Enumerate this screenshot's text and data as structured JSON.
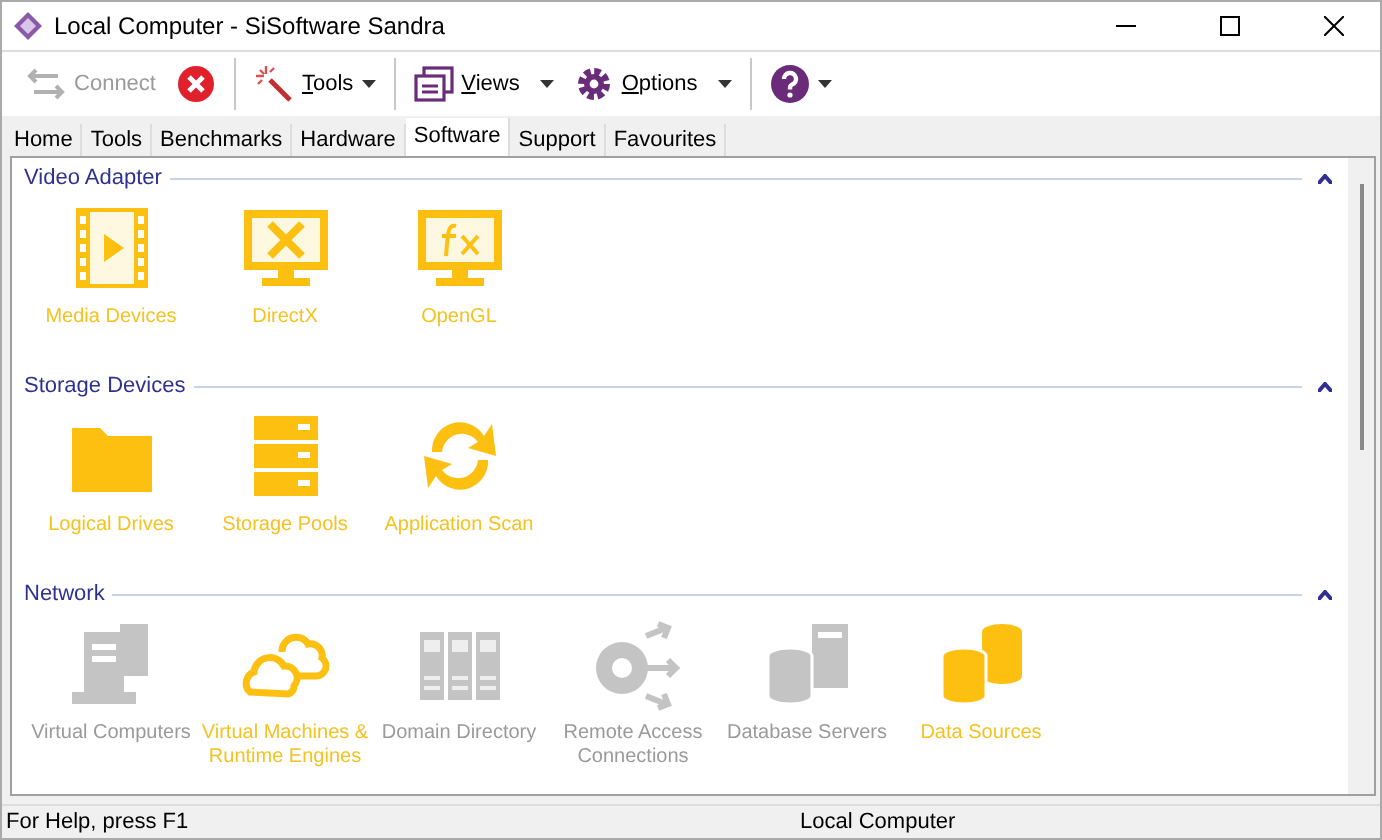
{
  "window": {
    "title": "Local Computer - SiSoftware Sandra"
  },
  "toolbar": [
    {
      "kind": "connect",
      "label": "Connect",
      "disabled": true
    },
    {
      "kind": "stop",
      "disabled": false
    },
    {
      "kind": "tools",
      "label": "Tools",
      "disabled": false
    },
    {
      "kind": "views",
      "label": "Views",
      "disabled": false
    },
    {
      "kind": "options",
      "label": "Options",
      "disabled": false
    },
    {
      "kind": "help",
      "disabled": false
    }
  ],
  "tabs": [
    {
      "label": "Home",
      "selected": false
    },
    {
      "label": "Tools",
      "selected": false
    },
    {
      "label": "Benchmarks",
      "selected": false
    },
    {
      "label": "Hardware",
      "selected": false
    },
    {
      "label": "Software",
      "selected": true
    },
    {
      "label": "Support",
      "selected": false
    },
    {
      "label": "Favourites",
      "selected": false
    }
  ],
  "sections": [
    {
      "title": "Video Adapter",
      "expanded": true,
      "items": [
        {
          "kind": "film",
          "label": "Media Devices",
          "enabled": true
        },
        {
          "kind": "monitor-x",
          "label": "DirectX",
          "enabled": true
        },
        {
          "kind": "monitor-fx",
          "label": "OpenGL",
          "enabled": true
        }
      ]
    },
    {
      "title": "Storage Devices",
      "expanded": true,
      "items": [
        {
          "kind": "folder",
          "label": "Logical Drives",
          "enabled": true
        },
        {
          "kind": "drawers",
          "label": "Storage Pools",
          "enabled": true
        },
        {
          "kind": "refresh",
          "label": "Application Scan",
          "enabled": true
        }
      ]
    },
    {
      "title": "Network",
      "expanded": true,
      "items": [
        {
          "kind": "computer",
          "label": "Virtual Computers",
          "enabled": false
        },
        {
          "kind": "clouds",
          "label": "Virtual Machines & Runtime Engines",
          "enabled": true
        },
        {
          "kind": "servers",
          "label": "Domain Directory",
          "enabled": false
        },
        {
          "kind": "share",
          "label": "Remote Access Connections",
          "enabled": false
        },
        {
          "kind": "dbserver",
          "label": "Database Servers",
          "enabled": false
        },
        {
          "kind": "cylinders",
          "label": "Data Sources",
          "enabled": true
        }
      ]
    }
  ],
  "status_bar": {
    "help": "For Help, press F1",
    "location": "Local Computer"
  }
}
